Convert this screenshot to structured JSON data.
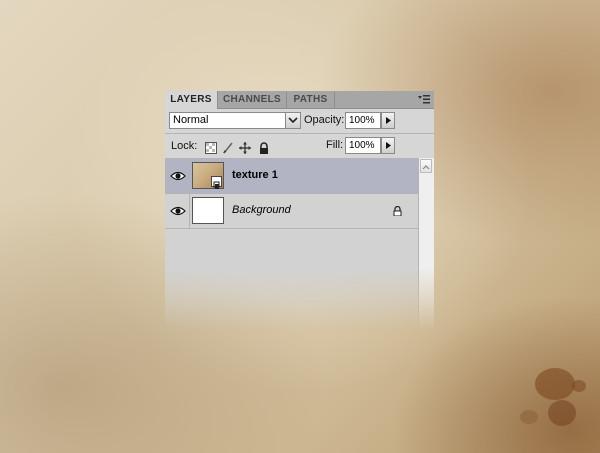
{
  "tabs": [
    {
      "label": "LAYERS",
      "active": true
    },
    {
      "label": "CHANNELS",
      "active": false
    },
    {
      "label": "PATHS",
      "active": false
    }
  ],
  "blend_mode": {
    "value": "Normal"
  },
  "opacity": {
    "label": "Opacity:",
    "value": "100%"
  },
  "lock": {
    "label": "Lock:",
    "icons": [
      "lock-transparent-icon",
      "lock-image-icon",
      "lock-position-icon",
      "lock-all-icon"
    ]
  },
  "fill": {
    "label": "Fill:",
    "value": "100%"
  },
  "layers": [
    {
      "name": "texture 1",
      "selected": true,
      "visible": true,
      "thumbnail": "texture",
      "smart_object": true,
      "locked": false
    },
    {
      "name": "Background",
      "selected": false,
      "visible": true,
      "thumbnail": "white",
      "smart_object": false,
      "locked": true
    }
  ],
  "colors": {
    "selected_layer": "#b2b4c3",
    "panel": "#d6d6d6",
    "tabbar": "#a6a6a6"
  }
}
